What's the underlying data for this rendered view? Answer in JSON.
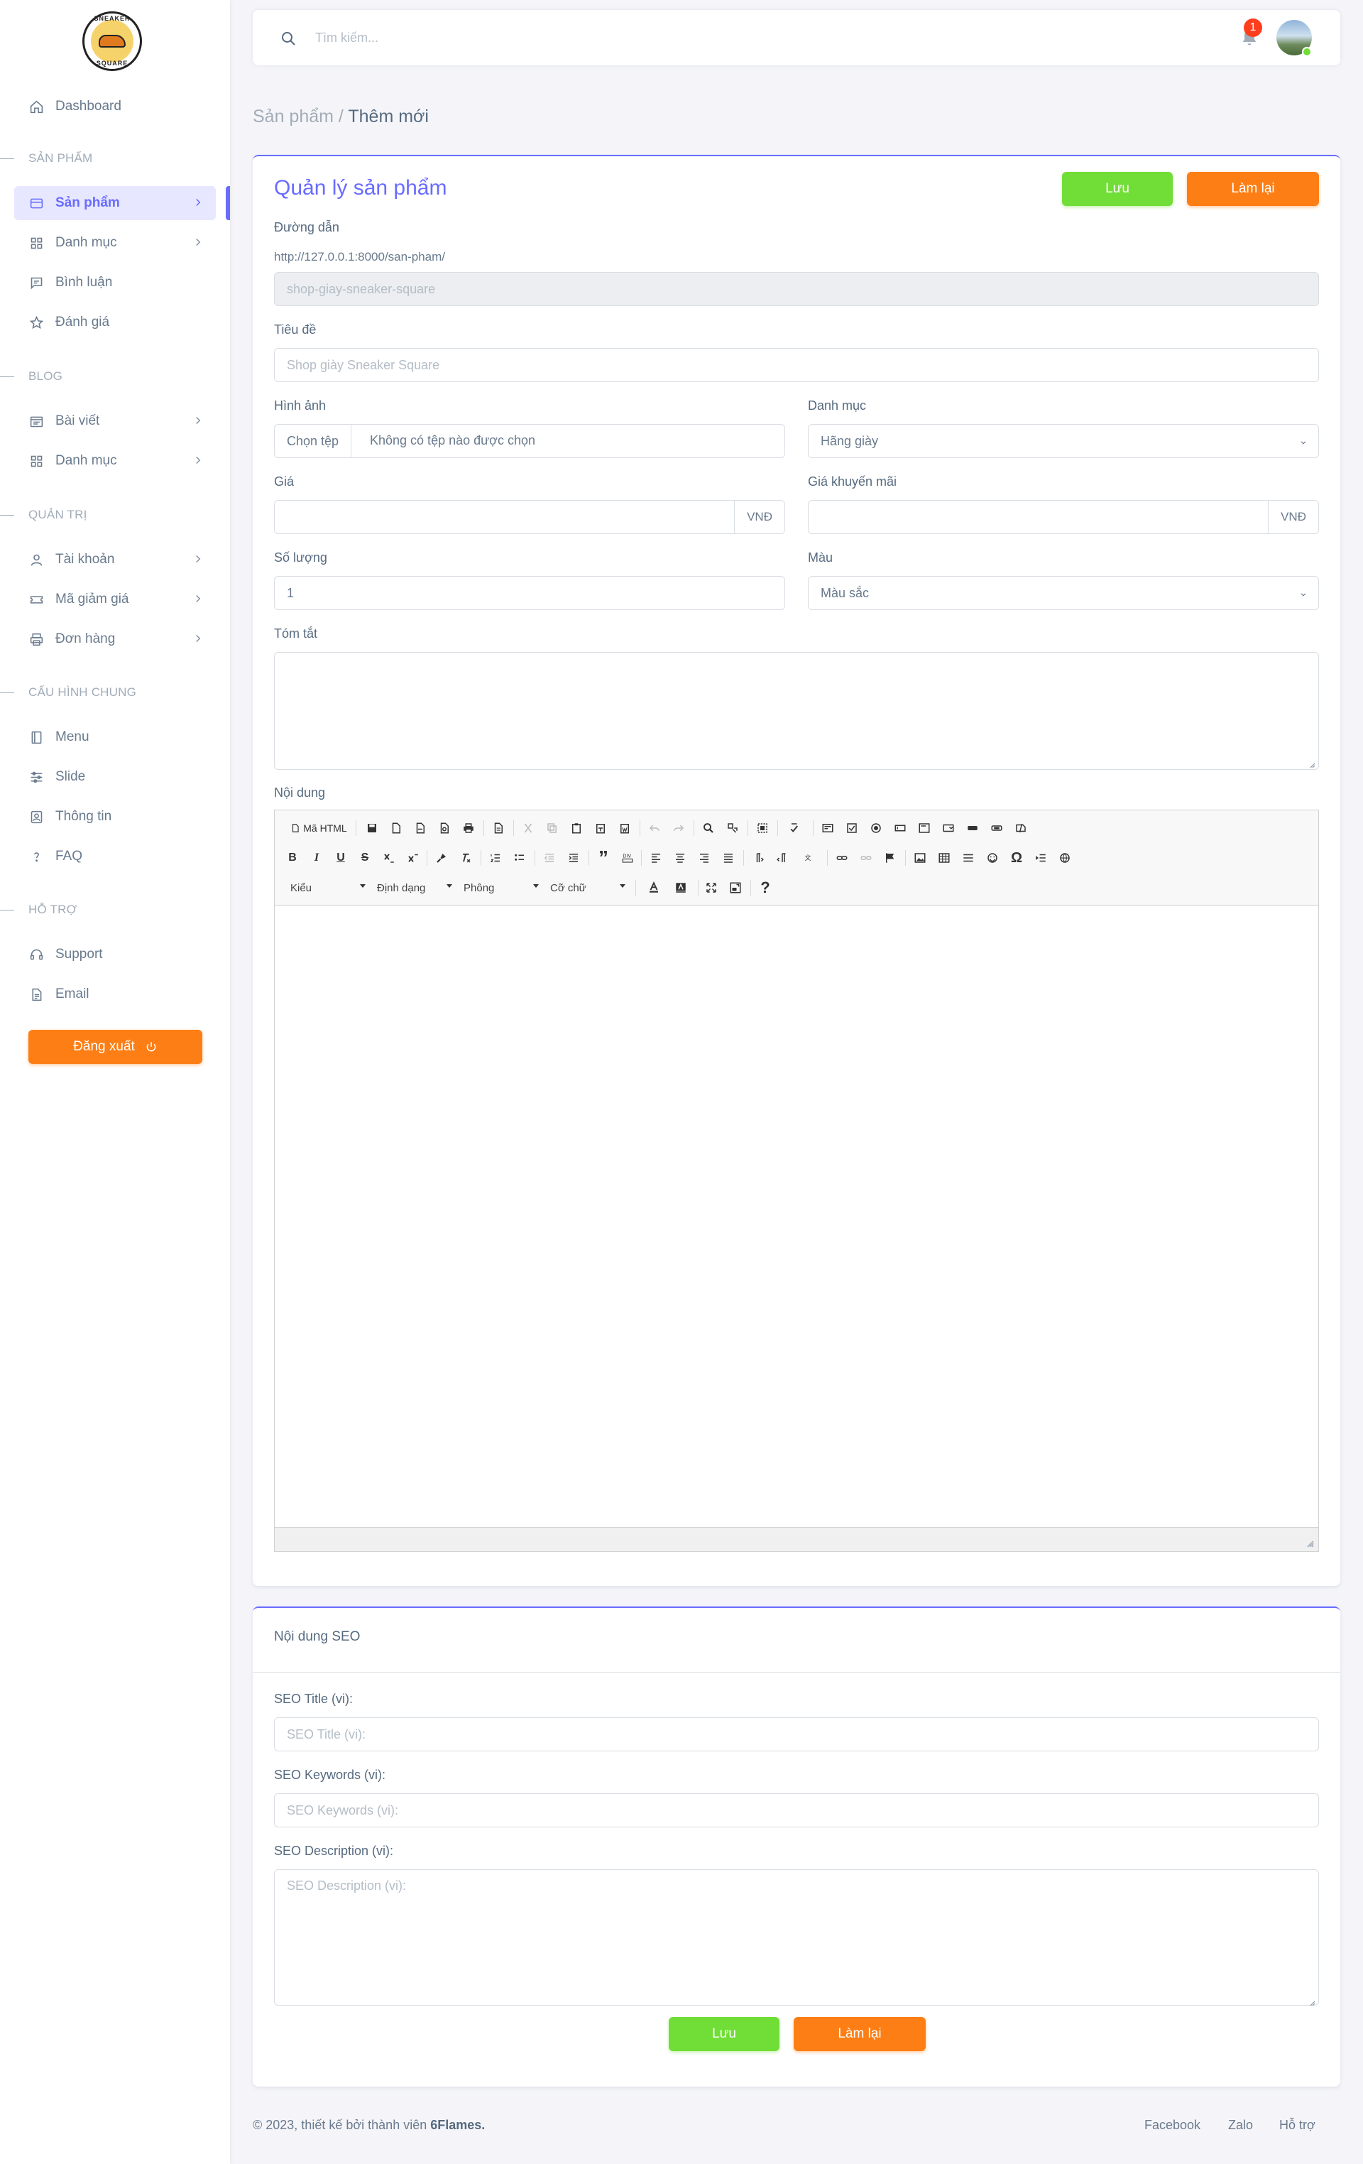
{
  "brand": {
    "logo_top_text": "SNEAKER",
    "logo_bottom_text": "SQUARE"
  },
  "sidebar": {
    "items": [
      {
        "label": "Dashboard",
        "icon": "home-icon"
      },
      {
        "label": "Sản phẩm",
        "icon": "credit-card-icon",
        "active": true
      },
      {
        "label": "Danh mục",
        "icon": "grid-icon"
      },
      {
        "label": "Bình luận",
        "icon": "comment-icon"
      },
      {
        "label": "Đánh giá",
        "icon": "star-icon"
      },
      {
        "label": "Bài viết",
        "icon": "newspaper-icon"
      },
      {
        "label": "Danh mục",
        "icon": "grid-icon"
      },
      {
        "label": "Tài khoản",
        "icon": "user-icon"
      },
      {
        "label": "Mã giảm giá",
        "icon": "ticket-icon"
      },
      {
        "label": "Đơn hàng",
        "icon": "printer-icon"
      },
      {
        "label": "Menu",
        "icon": "book-icon"
      },
      {
        "label": "Slide",
        "icon": "sliders-icon"
      },
      {
        "label": "Thông tin",
        "icon": "contact-icon"
      },
      {
        "label": "FAQ",
        "icon": "question-icon"
      },
      {
        "label": "Support",
        "icon": "headset-icon"
      },
      {
        "label": "Email",
        "icon": "file-icon"
      }
    ],
    "headers": [
      "SẢN PHẨM",
      "BLOG",
      "QUẢN TRỊ",
      "CẤU HÌNH CHUNG",
      "HỖ TRỢ"
    ],
    "logout_label": "Đăng xuất"
  },
  "navbar": {
    "search_placeholder": "Tìm kiếm...",
    "notification_count": "1"
  },
  "breadcrumb": {
    "parent": "Sản phẩm /",
    "current": "Thêm mới"
  },
  "form": {
    "title": "Quản lý sản phẩm",
    "save_label": "Lưu",
    "reset_label": "Làm lại",
    "path_label": "Đường dẫn",
    "path_prefix": "http://127.0.0.1:8000/san-pham/",
    "path_placeholder": "shop-giay-sneaker-square",
    "title_label": "Tiêu đề",
    "title_placeholder": "Shop giày Sneaker Square",
    "image_label": "Hình ảnh",
    "file_button": "Chọn tệp",
    "file_text": "Không có tệp nào được chọn",
    "category_label": "Danh mục",
    "category_selected": "Hãng giày",
    "price_label": "Giá",
    "price_unit": "VNĐ",
    "sale_price_label": "Giá khuyến mãi",
    "sale_price_unit": "VNĐ",
    "quantity_label": "Số lượng",
    "quantity_value": "1",
    "color_label": "Màu",
    "color_selected": "Màu sắc",
    "summary_label": "Tóm tắt",
    "content_label": "Nội dung"
  },
  "editor": {
    "source_label": "Mã HTML",
    "style_combo": "Kiểu",
    "format_combo": "Định dạng",
    "font_combo": "Phông",
    "size_combo": "Cỡ chữ",
    "bold": "B",
    "italic": "I",
    "underline": "U",
    "strike": "S",
    "help": "?"
  },
  "seo": {
    "heading": "Nội dung SEO",
    "title_label": "SEO Title (vi):",
    "title_placeholder": "SEO Title (vi):",
    "keywords_label": "SEO Keywords (vi):",
    "keywords_placeholder": "SEO Keywords (vi):",
    "description_label": "SEO Description (vi):",
    "description_placeholder": "SEO Description (vi):",
    "save_label": "Lưu",
    "reset_label": "Làm lại"
  },
  "footer": {
    "copyright_prefix": "© 2023, thiết kế bởi thành viên",
    "team": "6Flames.",
    "links": [
      "Facebook",
      "Zalo",
      "Hỗ trợ"
    ]
  },
  "colors": {
    "primary": "#696cff",
    "success": "#71dd37",
    "orange": "#fd7e14",
    "danger": "#ff3e1d"
  }
}
